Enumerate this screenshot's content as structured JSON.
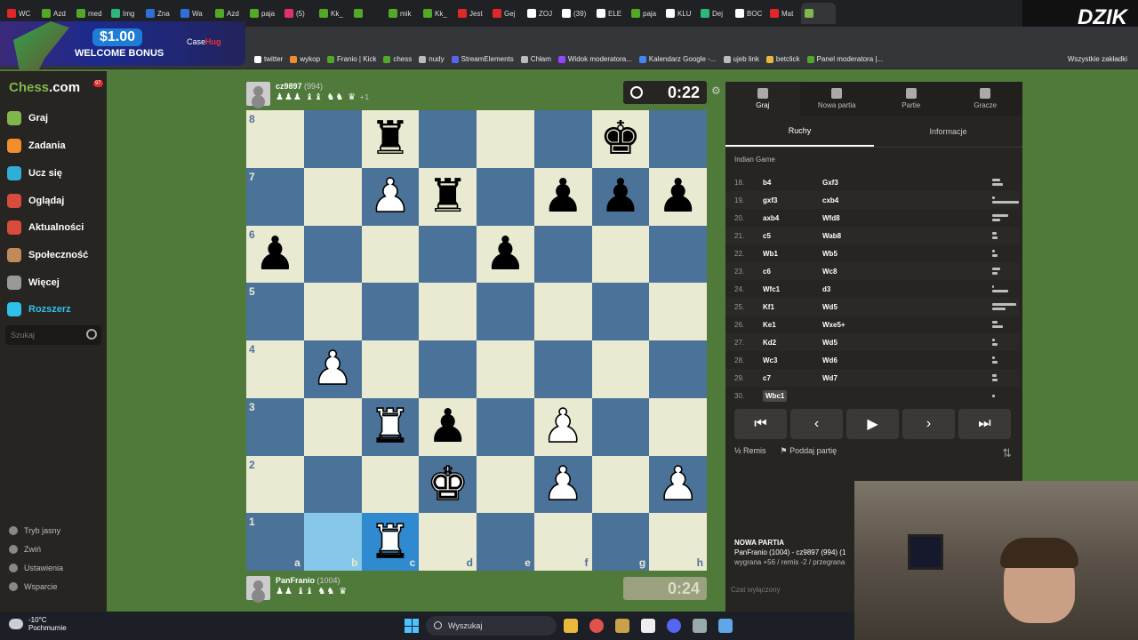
{
  "browser": {
    "tabs": [
      {
        "label": "WC",
        "color": "#e02828"
      },
      {
        "label": "Azd",
        "color": "#53a828"
      },
      {
        "label": "med",
        "color": "#53a828"
      },
      {
        "label": "Img",
        "color": "#2eb67d"
      },
      {
        "label": "Zna",
        "color": "#2f6fd6"
      },
      {
        "label": "Wa",
        "color": "#2f6fd6"
      },
      {
        "label": "Azd",
        "color": "#53a828"
      },
      {
        "label": "paja",
        "color": "#53a828"
      },
      {
        "label": "(5)",
        "color": "#e1306c"
      },
      {
        "label": "Kk_",
        "color": "#53a828"
      },
      {
        "label": "",
        "color": "#53a828"
      },
      {
        "label": "mik",
        "color": "#53a828"
      },
      {
        "label": "Kk_",
        "color": "#53a828"
      },
      {
        "label": "Jest",
        "color": "#e02828"
      },
      {
        "label": "Gej",
        "color": "#e02828"
      },
      {
        "label": "ZOJ",
        "color": "#ffffff"
      },
      {
        "label": "(39)",
        "color": "#ffffff"
      },
      {
        "label": "ELE",
        "color": "#ffffff"
      },
      {
        "label": "paja",
        "color": "#53a828"
      },
      {
        "label": "KLU",
        "color": "#ffffff"
      },
      {
        "label": "Dej",
        "color": "#2eb67d"
      },
      {
        "label": "BOC",
        "color": "#ffffff"
      },
      {
        "label": "Mat",
        "color": "#e02828"
      },
      {
        "label": "",
        "color": "#81b64c"
      }
    ],
    "brand_overlay": "DZIK",
    "bookmarks": [
      "twitter",
      "wykop",
      "Franio | Kick",
      "chess",
      "nudy",
      "StreamElements",
      "Chłam",
      "Widok moderatora...",
      "Kalendarz Google -...",
      "ujeb link",
      "betclick",
      "Panel moderatora |..."
    ],
    "all_bookmarks": "Wszystkie zakładki"
  },
  "ad": {
    "amount": "$1.00",
    "text": "WELCOME BONUS",
    "brand_a": "Case",
    "brand_b": "Hug"
  },
  "sidebar": {
    "logo_a": "Chess",
    "logo_b": ".com",
    "badge": "97",
    "items": [
      {
        "label": "Graj",
        "color": "#81b64c"
      },
      {
        "label": "Zadania",
        "color": "#f28d2b"
      },
      {
        "label": "Ucz się",
        "color": "#2faed8"
      },
      {
        "label": "Oglądaj",
        "color": "#d94b3c"
      },
      {
        "label": "Aktualności",
        "color": "#d94b3c"
      },
      {
        "label": "Społeczność",
        "color": "#c08a5a"
      },
      {
        "label": "Więcej",
        "color": "#999999"
      },
      {
        "label": "Rozszerz",
        "color": "#2fc2e8"
      }
    ],
    "search_placeholder": "Szukaj",
    "footer": [
      "Tryb jasny",
      "Zwiń",
      "Ustawienia",
      "Wsparcie"
    ]
  },
  "game": {
    "top_player": {
      "name": "cz9897",
      "rating": "(994)",
      "material": "♟♟♟ ♝♝ ♞♞ ♛",
      "material_diff": "+1"
    },
    "bottom_player": {
      "name": "PanFranio",
      "rating": "(1004)",
      "material": "♟♟ ♝♝ ♞♞ ♛"
    },
    "top_clock": "0:22",
    "bottom_clock": "0:24",
    "ranks": [
      "8",
      "7",
      "6",
      "5",
      "4",
      "3",
      "2",
      "1"
    ],
    "files": [
      "a",
      "b",
      "c",
      "d",
      "e",
      "f",
      "g",
      "h"
    ],
    "position": [
      [
        "",
        "",
        "bR",
        "",
        "",
        "",
        "bK",
        ""
      ],
      [
        "",
        "",
        "wP",
        "bR",
        "",
        "bP",
        "bP",
        "bP"
      ],
      [
        "bP",
        "",
        "",
        "",
        "bP",
        "",
        "",
        ""
      ],
      [
        "",
        "",
        "",
        "",
        "",
        "",
        "",
        ""
      ],
      [
        "",
        "wP",
        "",
        "",
        "",
        "",
        "",
        ""
      ],
      [
        "",
        "",
        "wR",
        "bP",
        "",
        "wP",
        "",
        ""
      ],
      [
        "",
        "",
        "",
        "wK",
        "",
        "wP",
        "",
        "wP"
      ],
      [
        "",
        "",
        "wR",
        "",
        "",
        "",
        "",
        ""
      ]
    ],
    "last_move_from": "b1",
    "last_move_to": "c1"
  },
  "panel": {
    "tabs": [
      "Graj",
      "Nowa partia",
      "Partie",
      "Gracze"
    ],
    "subtabs": [
      "Ruchy",
      "Informacje"
    ],
    "opening": "Indian Game",
    "moves": [
      {
        "n": "18.",
        "w": "b4",
        "b": "Gxf3"
      },
      {
        "n": "19.",
        "w": "gxf3",
        "b": "cxb4"
      },
      {
        "n": "20.",
        "w": "axb4",
        "b": "Wfd8"
      },
      {
        "n": "21.",
        "w": "c5",
        "b": "Wab8"
      },
      {
        "n": "22.",
        "w": "Wb1",
        "b": "Wb5"
      },
      {
        "n": "23.",
        "w": "c6",
        "b": "Wc8"
      },
      {
        "n": "24.",
        "w": "Wfc1",
        "b": "d3"
      },
      {
        "n": "25.",
        "w": "Kf1",
        "b": "Wd5"
      },
      {
        "n": "26.",
        "w": "Ke1",
        "b": "Wxe5+"
      },
      {
        "n": "27.",
        "w": "Kd2",
        "b": "Wd5"
      },
      {
        "n": "28.",
        "w": "Wc3",
        "b": "Wd6"
      },
      {
        "n": "29.",
        "w": "c7",
        "b": "Wd7"
      },
      {
        "n": "30.",
        "w": "Wbc1",
        "b": ""
      }
    ],
    "draw": "Remis",
    "resign": "Poddaj partię",
    "new_game_title": "NOWA PARTIA",
    "new_game_players": "PanFranio (1004) - cz9897 (994) (1",
    "new_game_result": "wygrana +56 / remis -2 / przegrana",
    "chat": "Czat wyłączony"
  },
  "taskbar": {
    "temp": "-10°C",
    "weather": "Pochmurnie",
    "search": "Wyszukaj"
  }
}
